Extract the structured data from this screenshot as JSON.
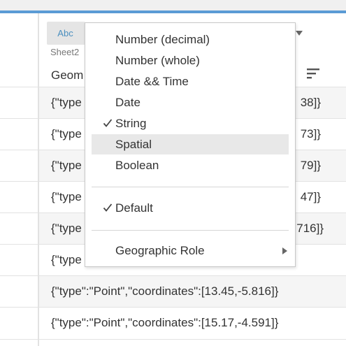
{
  "header": {
    "type_badge": "Abc",
    "sheet_label": "Sheet2",
    "column_title": "Geom"
  },
  "rows": [
    {
      "text": "{\"type",
      "tail": "38]}"
    },
    {
      "text": "{\"type",
      "tail": "73]}"
    },
    {
      "text": "{\"type",
      "tail": "79]}"
    },
    {
      "text": "{\"type",
      "tail": "47]}"
    },
    {
      "text": "{\"type",
      "tail": "716]}"
    },
    {
      "text": "{\"type",
      "tail": ""
    },
    {
      "text": "{\"type\":\"Point\",\"coordinates\":[13.45,-5.816]}",
      "tail": ""
    },
    {
      "text": "{\"type\":\"Point\",\"coordinates\":[15.17,-4.591]}",
      "tail": ""
    }
  ],
  "menu": {
    "data_types": [
      {
        "label": "Number (decimal)",
        "checked": false
      },
      {
        "label": "Number (whole)",
        "checked": false
      },
      {
        "label": "Date && Time",
        "checked": false
      },
      {
        "label": "Date",
        "checked": false
      },
      {
        "label": "String",
        "checked": true
      },
      {
        "label": "Spatial",
        "checked": false,
        "highlighted": true
      },
      {
        "label": "Boolean",
        "checked": false
      }
    ],
    "default_item": {
      "label": "Default",
      "checked": true
    },
    "geographic_role": {
      "label": "Geographic Role",
      "has_submenu": true
    }
  },
  "icons": {
    "check": "checkmark-icon",
    "submenu": "chevron-right-icon",
    "sort": "sort-icon",
    "dropdown": "caret-down-icon"
  },
  "colors": {
    "accent": "#5b9bd5",
    "badge_text": "#4a8fbf",
    "highlight": "#e8e8e8"
  }
}
